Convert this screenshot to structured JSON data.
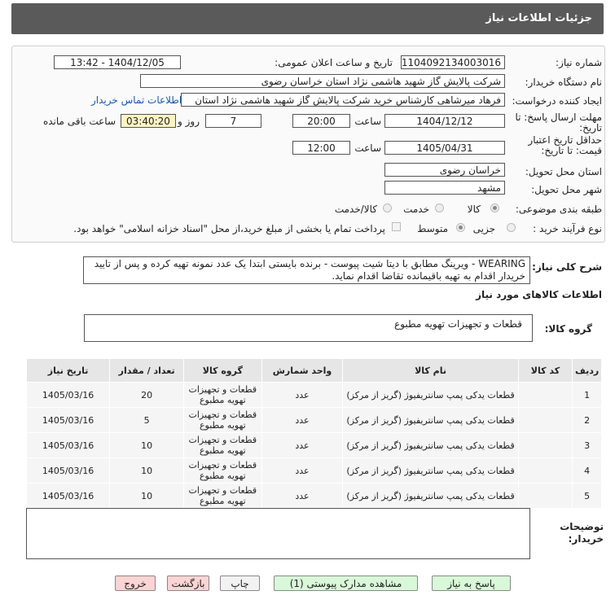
{
  "header": {
    "title": "جزئیات اطلاعات نیاز"
  },
  "form": {
    "need_number_label": "شماره نیاز:",
    "need_number": "1104092134003016",
    "announce_label": "تاریخ و ساعت اعلان عمومی:",
    "announce_value": "1404/12/05 - 13:42",
    "buyer_org_label": "نام دستگاه خریدار:",
    "buyer_org": "شرکت پالایش گاز شهید هاشمی نژاد   استان خراسان رضوی",
    "creator_label": "ایجاد کننده درخواست:",
    "creator": "فرهاد میرشاهی کارشناس خرید شرکت پالایش گاز شهید هاشمی نژاد   استان",
    "contact_link": "اطلاعات تماس خریدار",
    "deadline_label": "مهلت ارسال پاسخ: تا تاریخ:",
    "deadline_date": "1404/12/12",
    "time_label": "ساعت",
    "deadline_time": "20:00",
    "days": "7",
    "days_label": "روز و",
    "remaining": "03:40:20",
    "remaining_label": "ساعت باقی مانده",
    "min_price_label": "حداقل تاریخ اعتبار قیمت: تا تاریخ:",
    "min_price_date": "1405/04/31",
    "min_price_time": "12:00",
    "province_label": "استان محل تحویل:",
    "province": "خراسان رضوی",
    "city_label": "شهر محل تحویل:",
    "city": "مشهد",
    "category_label": "طبقه بندی موضوعی:",
    "category_options": [
      "کالا",
      "خدمت",
      "کالا/خدمت"
    ],
    "process_label": "نوع فرآیند خرید :",
    "process_options": [
      "جزیی",
      "متوسط"
    ],
    "payment_note": "پرداخت تمام یا بخشی از مبلغ خرید،از محل \"اسناد خزانه اسلامی\" خواهد بود."
  },
  "summary": {
    "label": "شرح کلی نیاز:",
    "text": "WEARING - ویرینگ مطابق با دیتا شیت پیوست - برنده بایستی ابتدا یک عدد نمونه تهیه کرده و پس از تایید خریدار اقدام به تهیه باقیمانده تقاضا اقدام نماید."
  },
  "goods": {
    "section_title": "اطلاعات کالاهای مورد نیاز",
    "group_label": "گروه کالا:",
    "group_value": "قطعات و تجهیزات تهویه مطبوع",
    "columns": [
      "ردیف",
      "کد کالا",
      "نام کالا",
      "واحد شمارش",
      "گروه کالا",
      "تعداد / مقدار",
      "تاریخ نیاز"
    ],
    "rows": [
      {
        "idx": "1",
        "code": "",
        "name": "قطعات یدکی پمپ سانتریفیوژ (گریز از مرکز)",
        "unit": "عدد",
        "group": "قطعات و تجهیزات تهویه مطبوع",
        "qty": "20",
        "date": "1405/03/16"
      },
      {
        "idx": "2",
        "code": "",
        "name": "قطعات یدکی پمپ سانتریفیوژ (گریز از مرکز)",
        "unit": "عدد",
        "group": "قطعات و تجهیزات تهویه مطبوع",
        "qty": "5",
        "date": "1405/03/16"
      },
      {
        "idx": "3",
        "code": "",
        "name": "قطعات یدکی پمپ سانتریفیوژ (گریز از مرکز)",
        "unit": "عدد",
        "group": "قطعات و تجهیزات تهویه مطبوع",
        "qty": "10",
        "date": "1405/03/16"
      },
      {
        "idx": "4",
        "code": "",
        "name": "قطعات یدکی پمپ سانتریفیوژ (گریز از مرکز)",
        "unit": "عدد",
        "group": "قطعات و تجهیزات تهویه مطبوع",
        "qty": "10",
        "date": "1405/03/16"
      },
      {
        "idx": "5",
        "code": "",
        "name": "قطعات یدکی پمپ سانتریفیوژ (گریز از مرکز)",
        "unit": "عدد",
        "group": "قطعات و تجهیزات تهویه مطبوع",
        "qty": "10",
        "date": "1405/03/16"
      }
    ]
  },
  "notes": {
    "label": "توضیحات خریدار:"
  },
  "buttons": {
    "reply": "پاسخ به نیاز",
    "attachments": "مشاهده مدارک پیوستی (1)",
    "print": "چاپ",
    "back": "بازگشت",
    "exit": "خروج"
  }
}
